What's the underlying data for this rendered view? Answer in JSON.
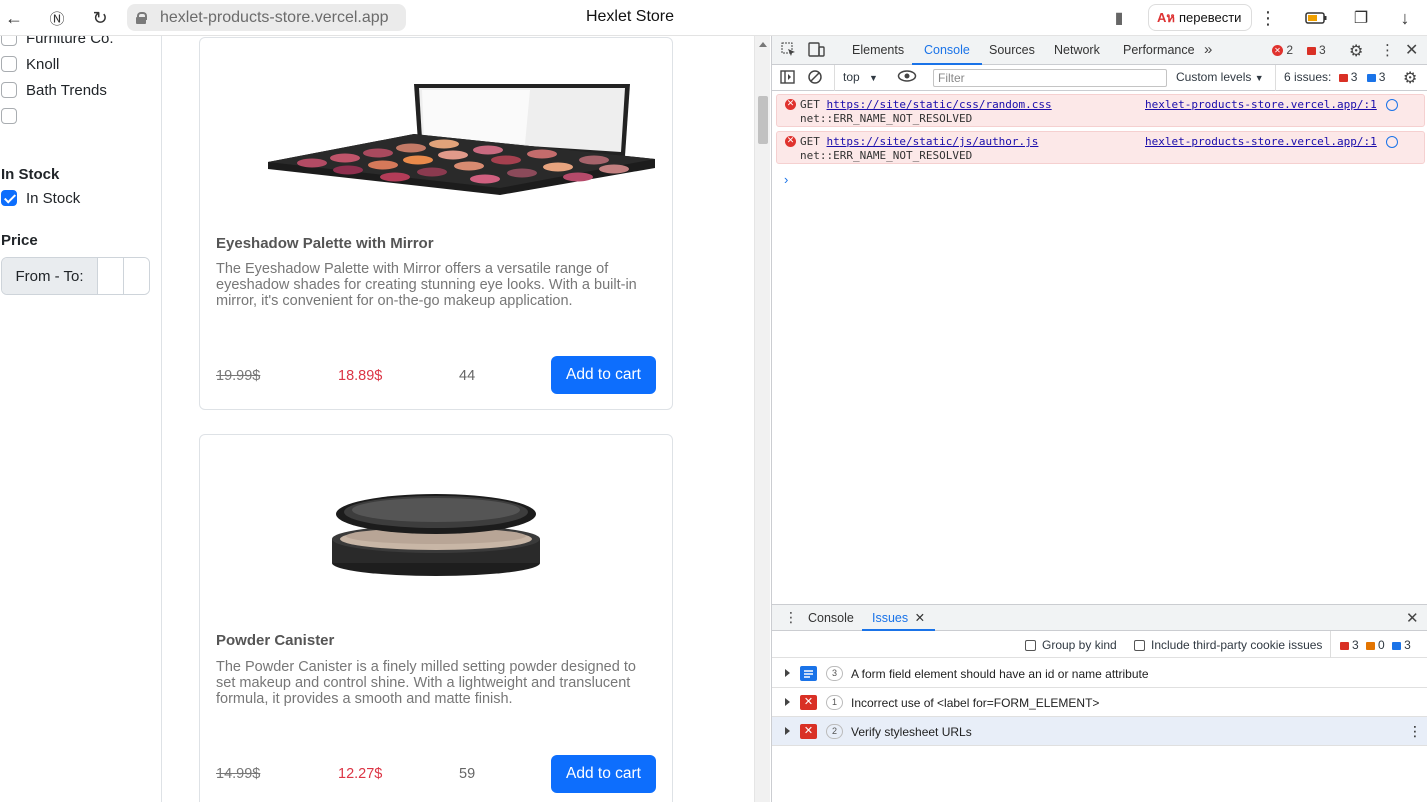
{
  "browser": {
    "url": "hexlet-products-store.vercel.app",
    "title": "Hexlet Store",
    "translate_label": "перевести"
  },
  "sidebar": {
    "brands": [
      {
        "label": "Furniture Co.",
        "checked": false
      },
      {
        "label": "Knoll",
        "checked": false
      },
      {
        "label": "Bath Trends",
        "checked": false
      },
      {
        "label": "",
        "checked": false
      }
    ],
    "stock_heading": "In Stock",
    "stock_option": {
      "label": "In Stock",
      "checked": true
    },
    "price_heading": "Price",
    "price_label": "From - To:"
  },
  "products": [
    {
      "title": "Eyeshadow Palette with Mirror",
      "description": "The Eyeshadow Palette with Mirror offers a versatile range of eyeshadow shades for creating stunning eye looks. With a built-in mirror, it's convenient for on-the-go makeup application.",
      "old_price": "19.99$",
      "new_price": "18.89$",
      "stock": "44",
      "button": "Add to cart"
    },
    {
      "title": "Powder Canister",
      "description": "The Powder Canister is a finely milled setting powder designed to set makeup and control shine. With a lightweight and translucent formula, it provides a smooth and matte finish.",
      "old_price": "14.99$",
      "new_price": "12.27$",
      "stock": "59",
      "button": "Add to cart"
    }
  ],
  "devtools": {
    "tabs": [
      "Elements",
      "Console",
      "Sources",
      "Network",
      "Performance"
    ],
    "active_tab": "Console",
    "error_count": "2",
    "issue_count_top": "3",
    "context": "top",
    "filter_placeholder": "Filter",
    "levels": "Custom levels",
    "issues_summary": "6 issues:",
    "issues_err": "3",
    "issues_info": "3",
    "messages": [
      {
        "method": "GET",
        "url": "https://site/static/css/random.css",
        "error": "net::ERR_NAME_NOT_RESOLVED",
        "source": "hexlet-products-store.vercel.app/:1"
      },
      {
        "method": "GET",
        "url": "https://site/static/js/author.js",
        "error": "net::ERR_NAME_NOT_RESOLVED",
        "source": "hexlet-products-store.vercel.app/:1"
      }
    ],
    "drawer": {
      "tabs": [
        "Console",
        "Issues"
      ],
      "active_tab": "Issues",
      "group_by_kind": "Group by kind",
      "third_party": "Include third-party cookie issues",
      "counts": {
        "errors": "3",
        "warnings": "0",
        "info": "3"
      },
      "issues": [
        {
          "type": "info",
          "count": "3",
          "text": "A form field element should have an id or name attribute"
        },
        {
          "type": "error",
          "count": "1",
          "text": "Incorrect use of <label for=FORM_ELEMENT>"
        },
        {
          "type": "error",
          "count": "2",
          "text": "Verify stylesheet URLs"
        }
      ]
    }
  }
}
